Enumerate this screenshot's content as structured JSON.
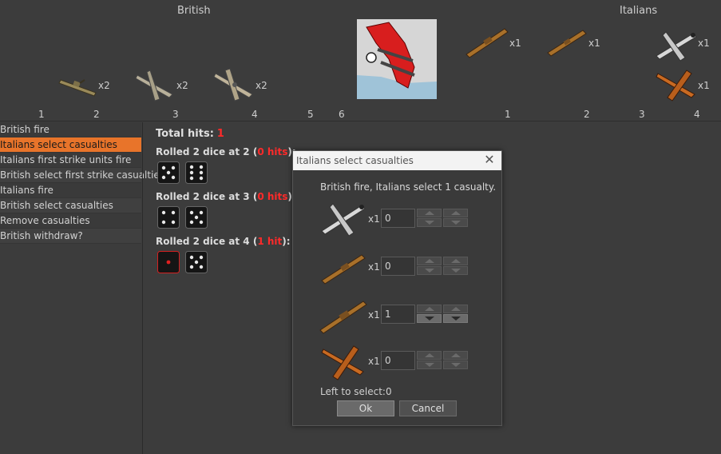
{
  "header": {
    "british_title": "British",
    "italians_title": "Italians"
  },
  "british_units": [
    {
      "icon": "destroyer-icon",
      "count": "x2"
    },
    {
      "icon": "fighter-plane-icon",
      "count": "x2"
    },
    {
      "icon": "bomber-plane-icon",
      "count": "x2"
    }
  ],
  "italian_units": [
    {
      "icon": "battleship-icon",
      "count": "x1"
    },
    {
      "icon": "cruiser-icon",
      "count": "x1"
    },
    {
      "icon": "fighter-plane-icon",
      "count": "x1"
    },
    {
      "icon": "tactical-bomber-icon",
      "count": "x1"
    }
  ],
  "british_columns": [
    "1",
    "2",
    "3",
    "4",
    "5",
    "6"
  ],
  "italian_columns": [
    "1",
    "2",
    "3",
    "4"
  ],
  "steps": [
    {
      "label": "British fire",
      "active": false
    },
    {
      "label": "Italians select casualties",
      "active": true
    },
    {
      "label": "Italians first strike units fire",
      "active": false
    },
    {
      "label": "British select first strike casualties",
      "active": false
    },
    {
      "label": "Italians fire",
      "active": false
    },
    {
      "label": "British select casualties",
      "active": false
    },
    {
      "label": "Remove casualties",
      "active": false
    },
    {
      "label": "British withdraw?",
      "active": false
    }
  ],
  "results": {
    "total_label": "Total hits:",
    "total_value": "1",
    "rolls": [
      {
        "prefix": "Rolled 2 dice at 2 (",
        "hits": "0 hits",
        "suffix": "):",
        "dice": [
          5,
          6
        ]
      },
      {
        "prefix": "Rolled 2 dice at 3 (",
        "hits": "0 hits",
        "suffix": "):",
        "dice": [
          4,
          5
        ]
      },
      {
        "prefix": "Rolled 2 dice at 4 (",
        "hits": "1 hit",
        "suffix": "):",
        "dice": [
          1,
          5
        ]
      }
    ]
  },
  "dialog": {
    "title": "Italians select casualties",
    "close": "✕",
    "message": "British fire,  Italians select 1 casualty.",
    "rows": [
      {
        "icon": "fighter-plane-icon",
        "count": "x1",
        "value": "0"
      },
      {
        "icon": "cruiser-icon",
        "count": "x1",
        "value": "0"
      },
      {
        "icon": "battleship-icon",
        "count": "x1",
        "value": "1"
      },
      {
        "icon": "tactical-bomber-icon",
        "count": "x1",
        "value": "0"
      }
    ],
    "left_to_select": "Left to select:0",
    "ok_label": "Ok",
    "cancel_label": "Cancel"
  },
  "colors": {
    "active_step": "#e8742a",
    "hit_red": "#ff2a2a",
    "background": "#3c3c3c"
  }
}
